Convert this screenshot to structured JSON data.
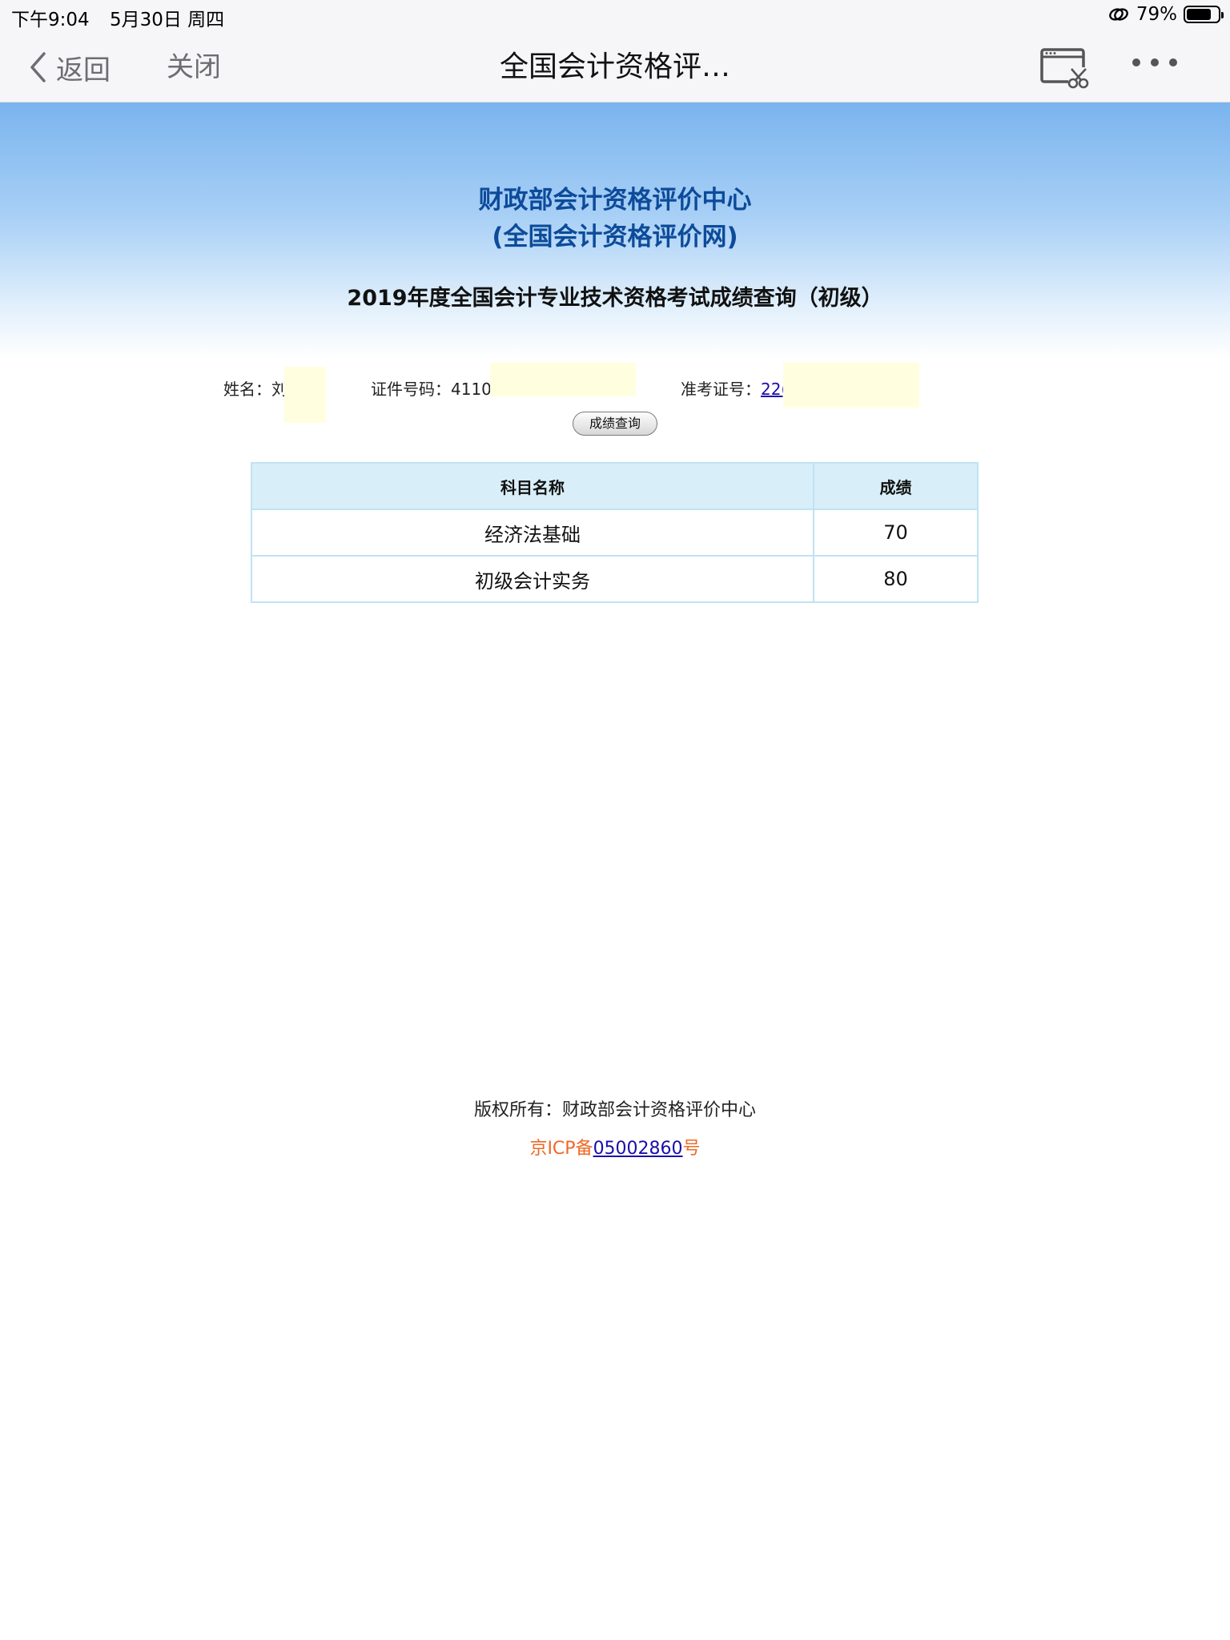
{
  "status_bar": {
    "time": "下午9:04",
    "date": "5月30日 周四",
    "battery_percent": "79%",
    "battery_level": 0.79
  },
  "nav": {
    "back_label": "返回",
    "close_label": "关闭",
    "title": "全国会计资格评…"
  },
  "header": {
    "org_line1": "财政部会计资格评价中心",
    "org_line2": "(全国会计资格评价网)",
    "exam_title": "2019年度全国会计专业技术资格考试成绩查询（初级）"
  },
  "info": {
    "name_label": "姓名：",
    "name_value": "刘",
    "id_label": "证件号码：",
    "id_value": "41102",
    "exam_label": "准考证号：",
    "exam_value": "22(",
    "query_button": "成绩查询"
  },
  "table": {
    "headers": [
      "科目名称",
      "成绩"
    ],
    "rows": [
      {
        "subject": "经济法基础",
        "score": "70"
      },
      {
        "subject": "初级会计实务",
        "score": "80"
      }
    ]
  },
  "footer": {
    "copyright": "版权所有：财政部会计资格评价中心",
    "icp_prefix": "京ICP备",
    "icp_number": "05002860",
    "icp_suffix": "号"
  }
}
